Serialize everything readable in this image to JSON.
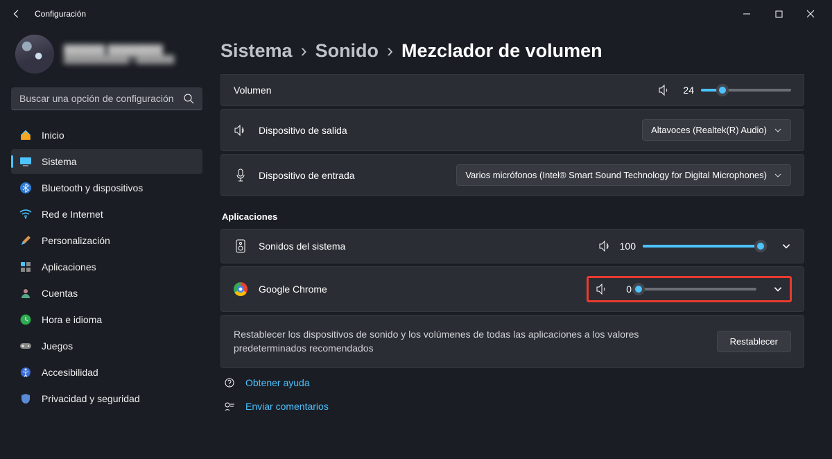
{
  "window": {
    "title": "Configuración"
  },
  "search": {
    "placeholder": "Buscar una opción de configuración"
  },
  "nav": {
    "home": "Inicio",
    "system": "Sistema",
    "bluetooth": "Bluetooth y dispositivos",
    "network": "Red e Internet",
    "personalization": "Personalización",
    "apps": "Aplicaciones",
    "accounts": "Cuentas",
    "time": "Hora e idioma",
    "gaming": "Juegos",
    "accessibility": "Accesibilidad",
    "privacy": "Privacidad y seguridad"
  },
  "breadcrumb": {
    "l1": "Sistema",
    "l2": "Sonido",
    "current": "Mezclador de volumen"
  },
  "volume": {
    "label": "Volumen",
    "value": "24",
    "percent": 24
  },
  "output": {
    "label": "Dispositivo de salida",
    "value": "Altavoces (Realtek(R) Audio)"
  },
  "input": {
    "label": "Dispositivo de entrada",
    "value": "Varios micrófonos (Intel® Smart Sound Technology for Digital Microphones)"
  },
  "apps_section": {
    "title": "Aplicaciones",
    "system_sounds": {
      "label": "Sonidos del sistema",
      "value": "100",
      "percent": 100
    },
    "chrome": {
      "label": "Google Chrome",
      "value": "0",
      "percent": 0
    }
  },
  "reset": {
    "text": "Restablecer los dispositivos de sonido y los volúmenes de todas las aplicaciones a los valores predeterminados recomendados",
    "button": "Restablecer"
  },
  "help": {
    "get_help": "Obtener ayuda",
    "feedback": "Enviar comentarios"
  }
}
